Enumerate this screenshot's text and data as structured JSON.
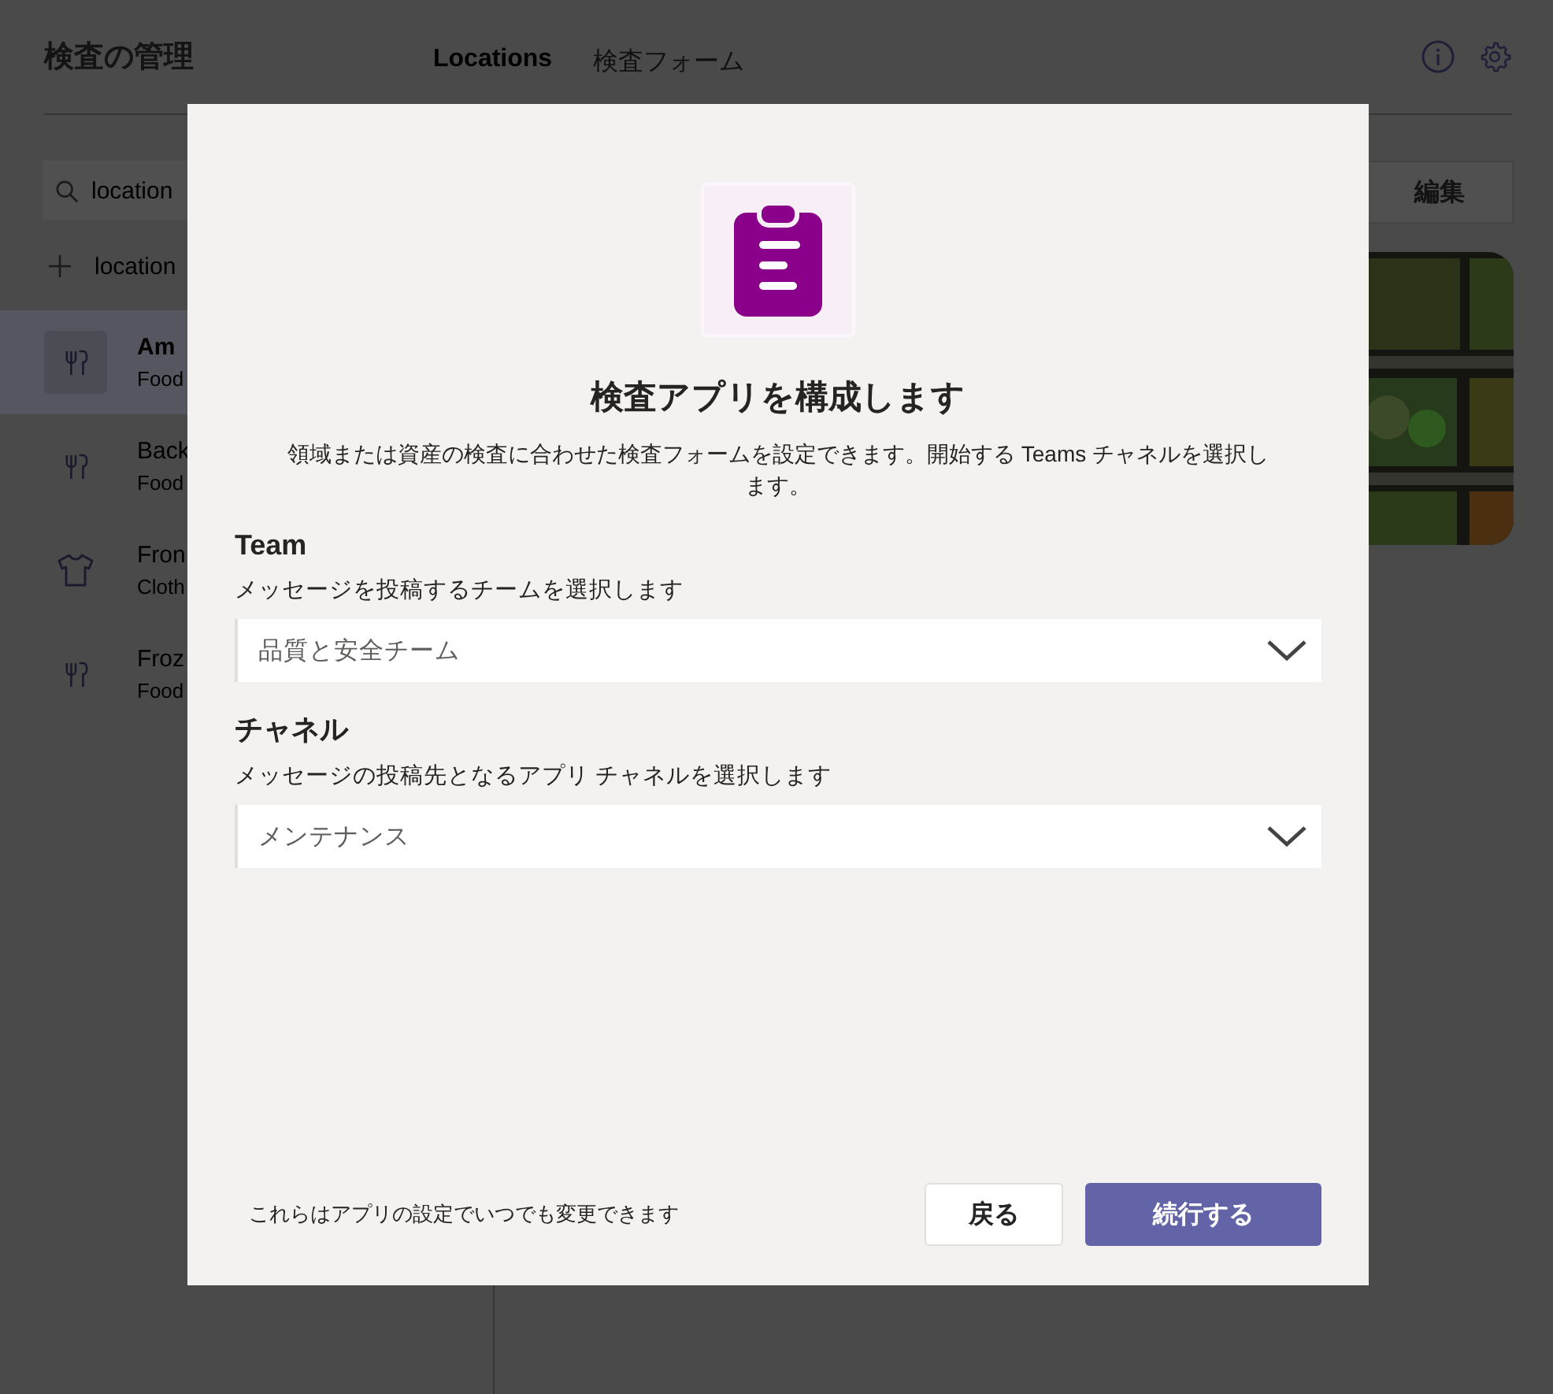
{
  "app": {
    "title": "検査の管理",
    "tabs": [
      {
        "label": "Locations",
        "selected": true
      },
      {
        "label": "検査フォーム",
        "selected": false
      }
    ],
    "search": {
      "value": "location"
    },
    "add": {
      "label": "location"
    },
    "locations": [
      {
        "name": "Am",
        "category": "Food",
        "kind": "food",
        "selected": true
      },
      {
        "name": "Back",
        "category": "Food",
        "kind": "food",
        "selected": false
      },
      {
        "name": "Fron",
        "category": "Cloth",
        "kind": "clothing",
        "selected": false
      },
      {
        "name": "Froz",
        "category": "Food",
        "kind": "food",
        "selected": false
      }
    ],
    "edit_button": "編集"
  },
  "dialog": {
    "title": "検査アプリを構成します",
    "description": "領域または資産の検査に合わせた検査フォームを設定できます。開始する Teams チャネルを選択します。",
    "fields": [
      {
        "label": "Team",
        "hint": "メッセージを投稿するチームを選択します",
        "value": "品質と安全チーム"
      },
      {
        "label": "チャネル",
        "hint": "メッセージの投稿先となるアプリ チャネルを選択します",
        "value": "メンテナンス"
      }
    ],
    "footer_note": "これらはアプリの設定でいつでも変更できます",
    "buttons": [
      {
        "label": "戻る",
        "kind": "secondary"
      },
      {
        "label": "続行する",
        "kind": "primary"
      }
    ]
  }
}
